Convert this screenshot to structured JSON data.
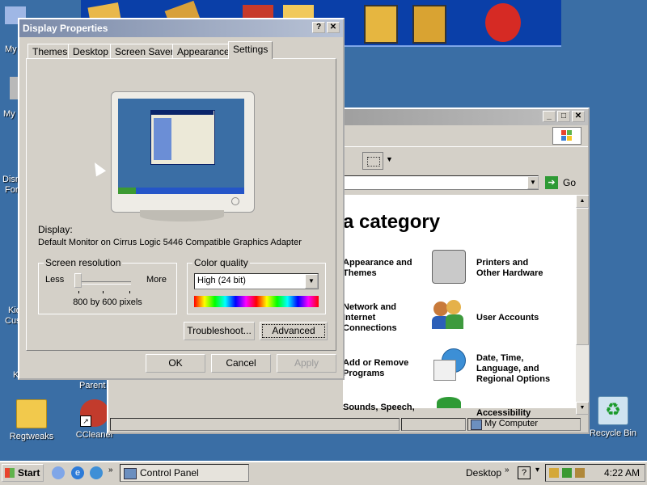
{
  "desktop": {
    "icons": [
      {
        "label": "My"
      },
      {
        "label": "My"
      },
      {
        "label": "Disn"
      },
      {
        "label": "For"
      },
      {
        "label": "Kid"
      },
      {
        "label": "Cus"
      },
      {
        "label": "K"
      },
      {
        "label": "Parent"
      },
      {
        "label": "Regtweaks"
      },
      {
        "label": "CCleaner"
      },
      {
        "label": "Recycle Bin"
      }
    ]
  },
  "control_panel": {
    "address_go": "Go",
    "heading": "a category",
    "categories": [
      {
        "label_line1": "Appearance and",
        "label_line2": "Themes"
      },
      {
        "label_line1": "Printers and",
        "label_line2": "Other Hardware"
      },
      {
        "label_line1": "Network and",
        "label_line2": "Internet",
        "label_line3": "Connections"
      },
      {
        "label_line1": "User Accounts"
      },
      {
        "label_line1": "Add or Remove",
        "label_line2": "Programs"
      },
      {
        "label_line1": "Date, Time,",
        "label_line2": "Language, and",
        "label_line3": "Regional Options"
      },
      {
        "label_line1": "Sounds, Speech,"
      },
      {
        "label_line1": "Accessibility"
      }
    ],
    "status_location": "My Computer"
  },
  "dialog": {
    "title": "Display Properties",
    "help_btn": "?",
    "close_btn": "✕",
    "tabs": [
      "Themes",
      "Desktop",
      "Screen Saver",
      "Appearance",
      "Settings"
    ],
    "display_label": "Display:",
    "display_value": "Default Monitor on Cirrus Logic 5446 Compatible Graphics Adapter",
    "resolution": {
      "group_label": "Screen resolution",
      "less": "Less",
      "more": "More",
      "value": "800 by 600 pixels",
      "slider_position": 0
    },
    "color_quality": {
      "group_label": "Color quality",
      "selected": "High (24 bit)"
    },
    "troubleshoot_btn": "Troubleshoot...",
    "advanced_btn": "Advanced",
    "ok_btn": "OK",
    "cancel_btn": "Cancel",
    "apply_btn": "Apply"
  },
  "taskbar": {
    "start": "Start",
    "task": "Control Panel",
    "desktop_label": "Desktop",
    "time": "4:22 AM"
  },
  "colors": {
    "desktop_bg": "#3a6ea5",
    "title_inactive": "#808080"
  }
}
